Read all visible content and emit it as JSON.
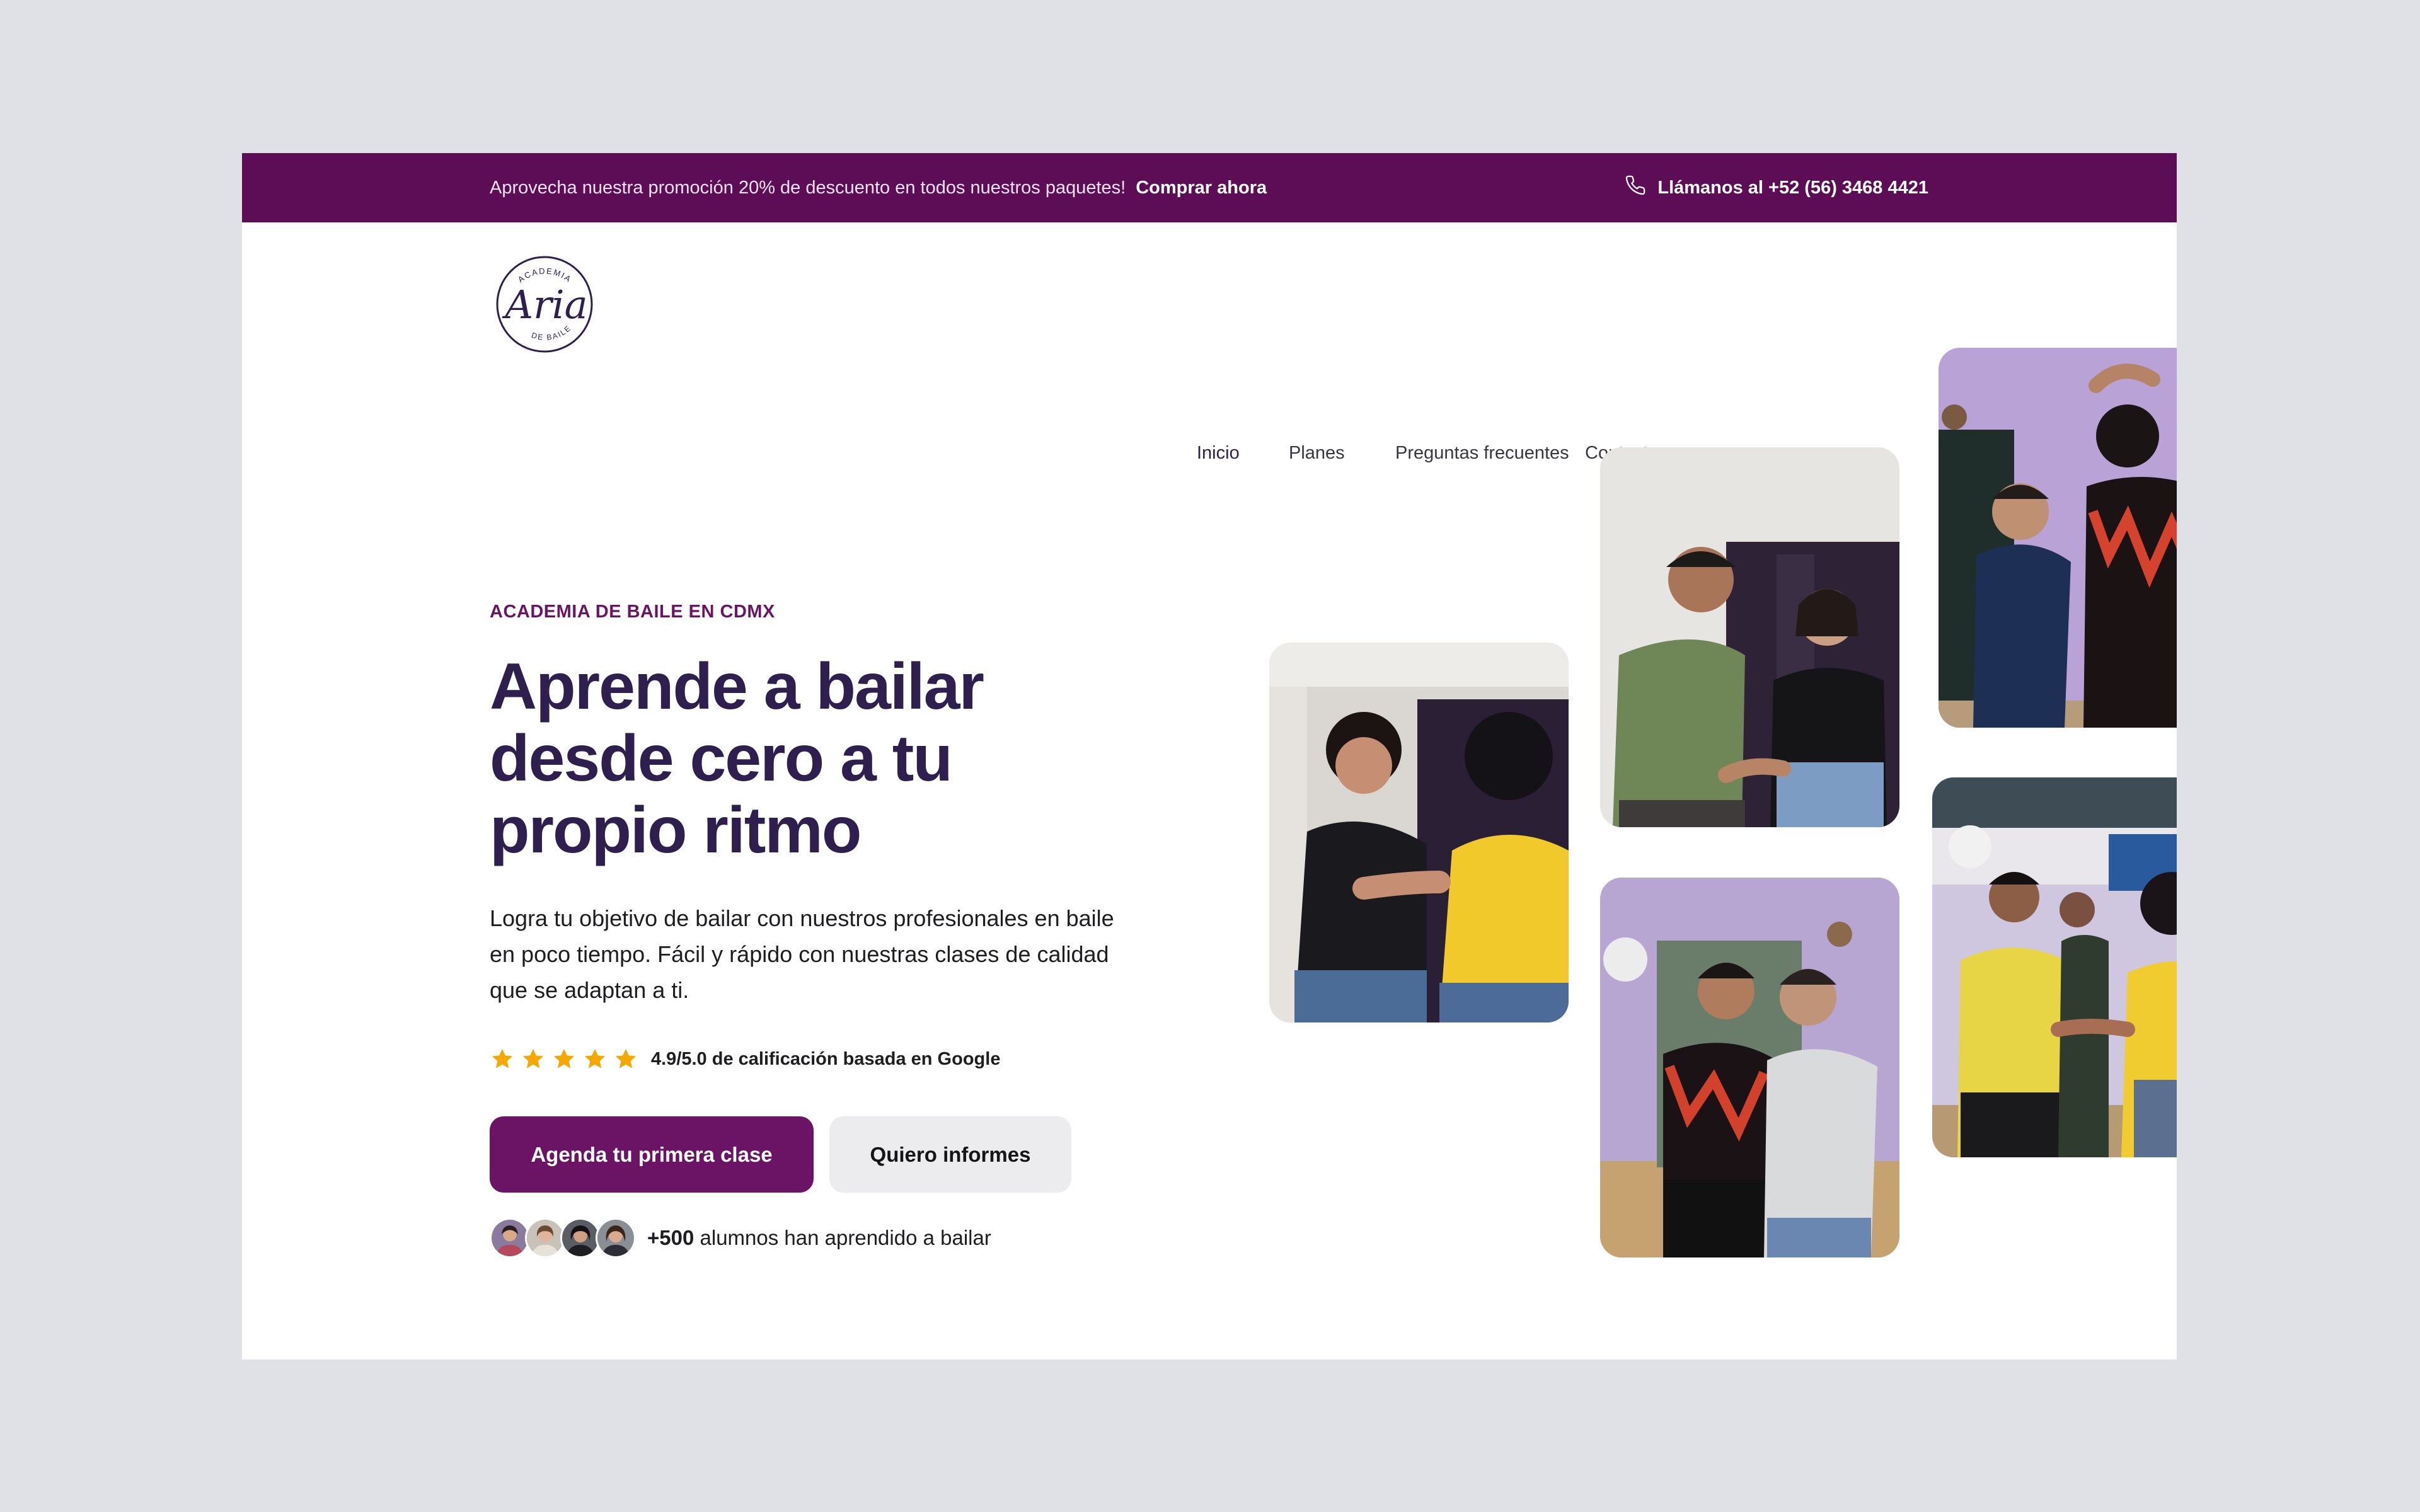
{
  "promo": {
    "message": "Aprovecha nuestra promoción 20% de descuento en todos nuestros paquetes!",
    "cta": "Comprar ahora",
    "phone": "Llámanos al +52 (56) 3468 4421",
    "background": "#5c0d56"
  },
  "logo": {
    "top_text": "ACADEMIA",
    "name": "Aria",
    "bottom_text": "DE BAILE"
  },
  "nav": {
    "items": [
      {
        "label": "Inicio"
      },
      {
        "label": "Planes"
      },
      {
        "label": "Preguntas frecuentes"
      },
      {
        "label": "Contacto"
      }
    ],
    "active": "Inicio"
  },
  "social": {
    "icons": [
      "facebook-icon",
      "tiktok-icon",
      "whatsapp-icon"
    ]
  },
  "hero": {
    "eyebrow": "ACADEMIA DE BAILE EN CDMX",
    "headline_1": "Aprende a bailar",
    "headline_2": "desde cero a tu",
    "headline_3": "propio ritmo",
    "lead": "Logra tu objetivo de bailar con nuestros profesionales en baile en poco tiempo. Fácil y rápido con nuestras clases de calidad que se adaptan a ti.",
    "rating_stars": 5,
    "rating_text": "4.9/5.0 de calificación basada en Google",
    "primary_cta": "Agenda tu primera clase",
    "secondary_cta": "Quiero informes",
    "students_count": "+500",
    "students_text": "alumnos han aprendido a bailar"
  },
  "colors": {
    "brand_purple": "#6b1466",
    "headline": "#2e1f4f",
    "star": "#f5a800"
  }
}
